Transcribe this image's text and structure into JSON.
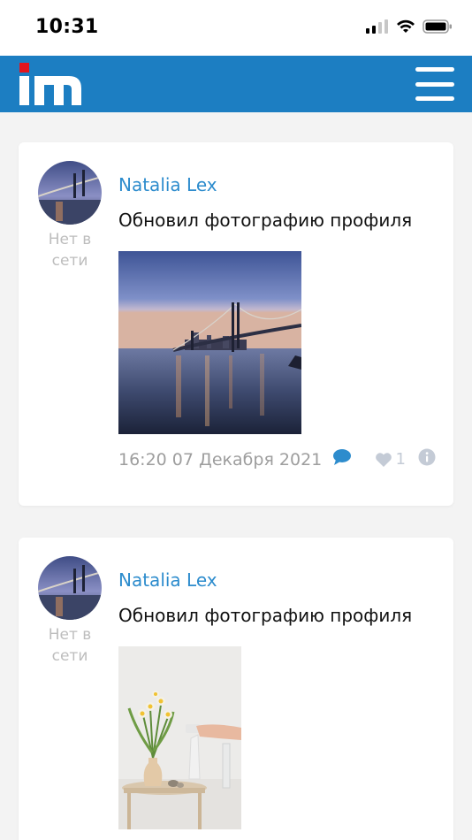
{
  "status_bar": {
    "time": "10:31"
  },
  "header": {
    "logo_text": "im",
    "brand_color": "#1c7ec2",
    "logo_accent": "#e3151d"
  },
  "posts": [
    {
      "author": "Natalia Lex",
      "presence": "Нет в сети",
      "text": "Обновил фотографию профиля",
      "photo": "bridge-at-dusk",
      "timestamp": "16:20 07 Декабря 2021",
      "likes": "1"
    },
    {
      "author": "Natalia Lex",
      "presence": "Нет в сети",
      "text": "Обновил фотографию профиля",
      "photo": "flowers-in-vase",
      "timestamp": "",
      "likes": ""
    }
  ],
  "colors": {
    "accent": "#2d8ccd",
    "muted": "#9e9e9e",
    "background": "#f3f3f3"
  }
}
